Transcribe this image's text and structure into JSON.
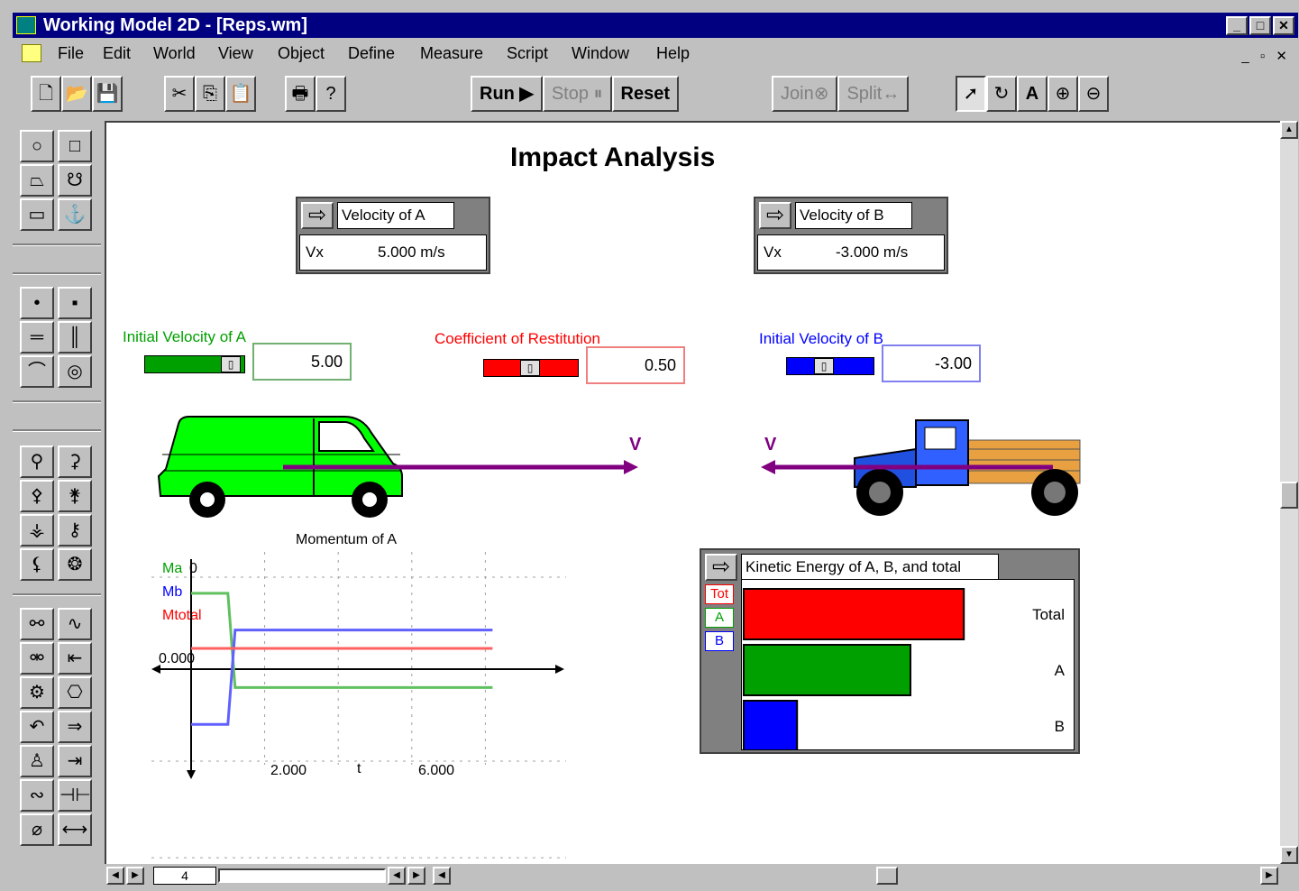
{
  "window": {
    "title": "Working Model 2D - [Reps.wm]",
    "buttons": {
      "minimize": "_",
      "maximize": "□",
      "close": "✕"
    }
  },
  "menu": {
    "items": [
      "File",
      "Edit",
      "World",
      "View",
      "Object",
      "Define",
      "Measure",
      "Script",
      "Window",
      "Help"
    ],
    "mdi_buttons": "_ ▫ ✕"
  },
  "toolbar": {
    "run": "Run ▶",
    "stop": "Stop ⏸",
    "reset": "Reset",
    "join": "Join⊗",
    "split": "Split↔"
  },
  "scene": {
    "title": "Impact Analysis",
    "arrow_label_a": "V",
    "arrow_label_b": "V"
  },
  "meter_va": {
    "title": "Velocity of A",
    "label": "Vx",
    "value": "5.000 m/s"
  },
  "meter_vb": {
    "title": "Velocity of B",
    "label": "Vx",
    "value": "-3.000 m/s"
  },
  "controls": {
    "va": {
      "label": "Initial Velocity of A",
      "value": "5.00"
    },
    "cor": {
      "label": "Coefficient of Restitution",
      "value": "0.50"
    },
    "vb": {
      "label": "Initial Velocity of B",
      "value": "-3.00"
    }
  },
  "momentum_graph": {
    "title": "Momentum of A",
    "legend": [
      "Ma",
      "Mb",
      "Mtotal"
    ],
    "y_top_label": "0",
    "y_zero_label": "0.000",
    "x_ticks": [
      "2.000",
      "6.000"
    ],
    "x_label": "t"
  },
  "ke_meter": {
    "title": "Kinetic Energy of A, B, and total",
    "tabs": [
      "Tot",
      "A",
      "B"
    ],
    "labels": [
      "Total",
      "A",
      "B"
    ]
  },
  "statusbar": {
    "frame": "4"
  },
  "colors": {
    "green": "#00a000",
    "red": "#ff0000",
    "blue": "#0000ff",
    "purple": "#800080",
    "titlebar": "#000080"
  },
  "chart_data": [
    {
      "type": "bar",
      "title": "Kinetic Energy of A, B, and total",
      "categories": [
        "Total",
        "A",
        "B"
      ],
      "values": [
        0.66,
        0.5,
        0.16
      ],
      "xlim": [
        0,
        1
      ]
    },
    {
      "type": "line",
      "title": "Momentum of A",
      "xlabel": "t",
      "x": [
        0,
        1,
        1,
        8
      ],
      "series": [
        {
          "name": "Ma",
          "values": [
            3.3,
            3.3,
            -0.8,
            -0.8
          ]
        },
        {
          "name": "Mb",
          "values": [
            -2.4,
            -2.4,
            1.7,
            1.7
          ]
        },
        {
          "name": "Mtotal",
          "values": [
            0.9,
            0.9,
            0.9,
            0.9
          ]
        }
      ]
    }
  ]
}
